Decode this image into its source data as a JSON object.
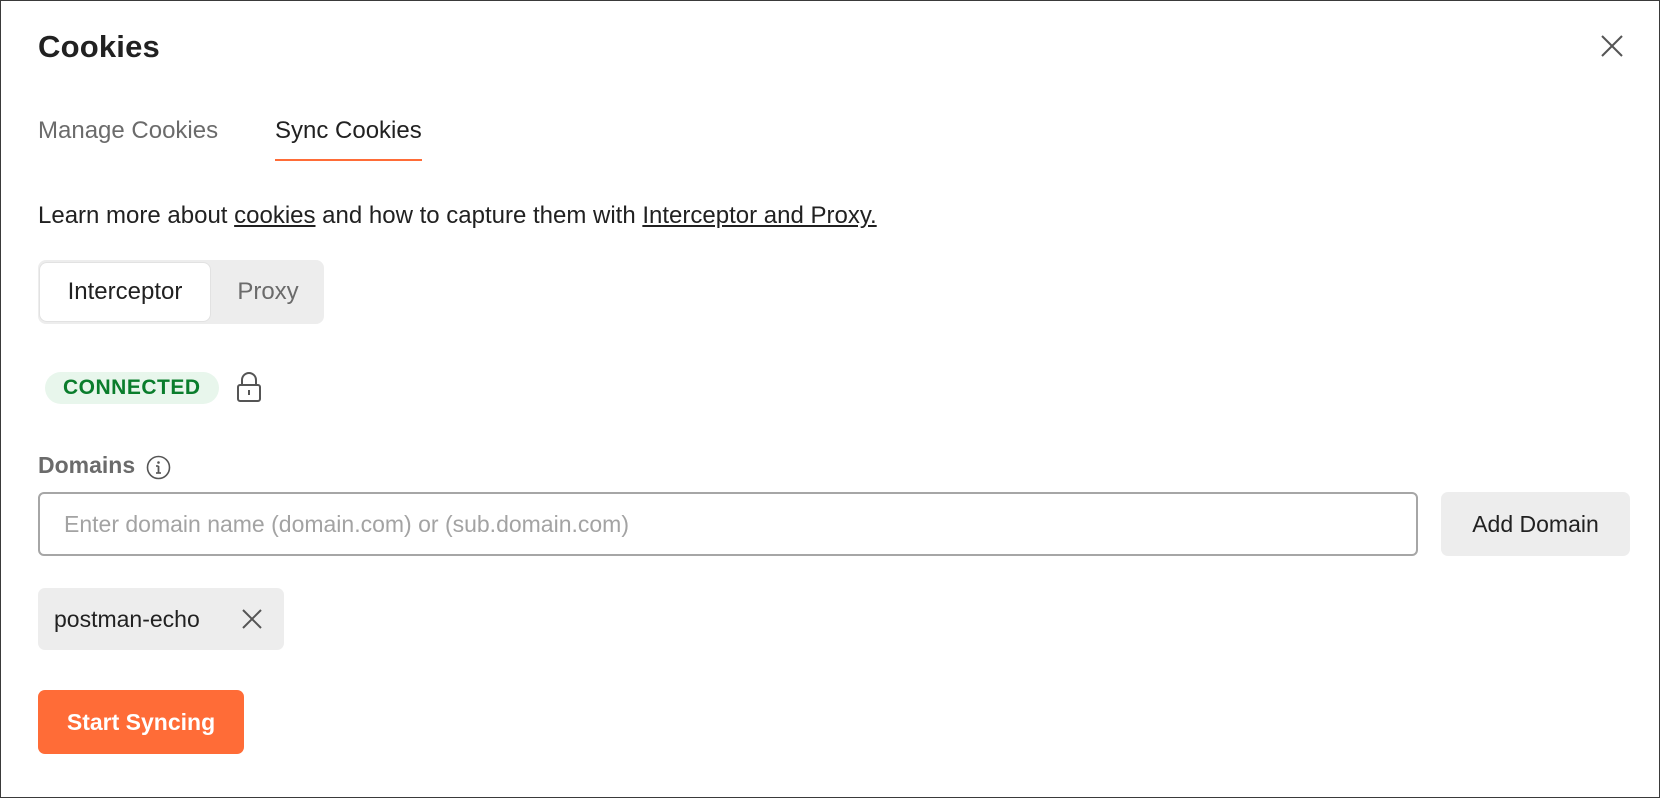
{
  "dialog": {
    "title": "Cookies"
  },
  "tabs": [
    {
      "label": "Manage Cookies",
      "active": false
    },
    {
      "label": "Sync Cookies",
      "active": true
    }
  ],
  "learn_more": {
    "prefix": "Learn more about ",
    "link_cookies": "cookies",
    "middle": " and how to capture them with ",
    "link_interceptor": "Interceptor and Proxy."
  },
  "mode_toggle": {
    "options": [
      "Interceptor",
      "Proxy"
    ],
    "selected": "Interceptor"
  },
  "status": {
    "badge": "CONNECTED",
    "badge_color": "#0a7d2c",
    "badge_bg": "#e8f6ec",
    "lock_icon": "lock-icon"
  },
  "domains": {
    "label": "Domains",
    "info_icon": "info-icon",
    "input_value": "",
    "input_placeholder": "Enter domain name (domain.com) or (sub.domain.com)",
    "add_button": "Add Domain",
    "items": [
      {
        "name": "postman-echo"
      }
    ]
  },
  "actions": {
    "start_syncing": "Start Syncing"
  },
  "colors": {
    "accent": "#ff6c37",
    "text": "#212121",
    "muted": "#6b6b6b"
  }
}
